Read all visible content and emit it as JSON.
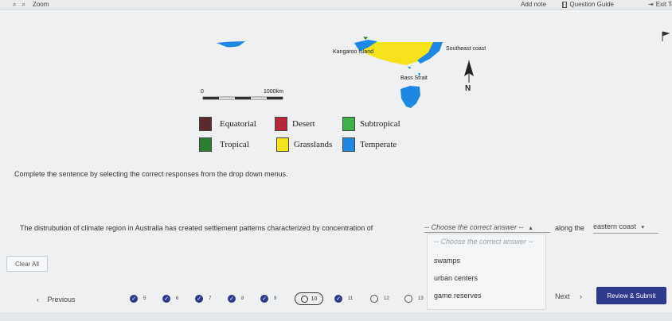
{
  "toolbar": {
    "zoom_label": "Zoom",
    "add_note": "Add note",
    "question_guide": "Question Guide",
    "exit": "Exit Te"
  },
  "map": {
    "labels": {
      "kangaroo_island": "Kangaroo Island",
      "southeast_coast": "Southeast coast",
      "bass_strait": "Bass Strait",
      "scale_zero": "0",
      "scale_max": "1000km",
      "north": "N"
    },
    "colors": {
      "equatorial": "#5a2a2e",
      "desert": "#b22a3a",
      "subtropical": "#3bb54a",
      "tropical": "#2e7d32",
      "grasslands": "#f4e21b",
      "temperate": "#1e88e5"
    }
  },
  "legend": [
    {
      "label": "Equatorial",
      "color": "#5a2a2e"
    },
    {
      "label": "Desert",
      "color": "#b22a3a"
    },
    {
      "label": "Subtropical",
      "color": "#3bb54a"
    },
    {
      "label": "Tropical",
      "color": "#2e7d32"
    },
    {
      "label": "Grasslands",
      "color": "#f4e21b"
    },
    {
      "label": "Temperate",
      "color": "#1e88e5"
    }
  ],
  "instructions": "Complete the sentence by selecting the correct responses from the drop down menus.",
  "sentence": {
    "part1": "The distrubution of climate region in Australia has created settlement patterns characterized by concentration of",
    "dropdown1_value": "-- Choose the correct answer --",
    "part2": "along the",
    "dropdown2_value": "eastern coast"
  },
  "dropdown_menu": {
    "placeholder": "-- Choose the correct answer --",
    "options": [
      "swamps",
      "urban centers",
      "game reserves"
    ]
  },
  "clear_all": "Clear All",
  "navigation": {
    "previous": "Previous",
    "next": "Next",
    "review_submit": "Review & Submit",
    "questions": [
      {
        "num": "5",
        "answered": true
      },
      {
        "num": "6",
        "answered": true
      },
      {
        "num": "7",
        "answered": true
      },
      {
        "num": "8",
        "answered": true
      },
      {
        "num": "9",
        "answered": true
      },
      {
        "num": "10",
        "answered": false,
        "current": true
      },
      {
        "num": "11",
        "answered": true
      },
      {
        "num": "12",
        "answered": false
      },
      {
        "num": "13",
        "answered": false
      }
    ]
  }
}
